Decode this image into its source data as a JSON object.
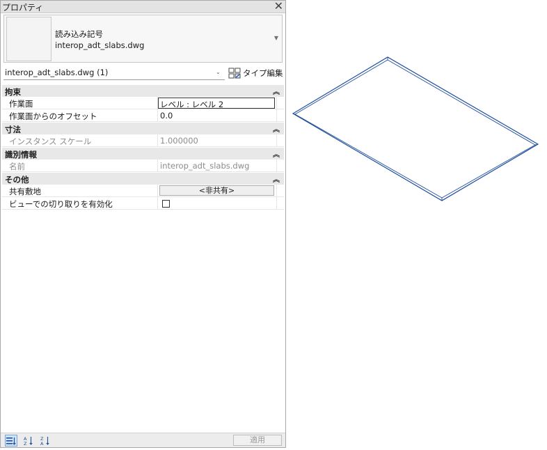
{
  "palette": {
    "title": "プロパティ",
    "close_glyph": "✕",
    "type_selector": {
      "family": "読み込み記号",
      "type": "interop_adt_slabs.dwg",
      "dropdown_glyph": "▼"
    },
    "instance_filter": {
      "label": "interop_adt_slabs.dwg (1)",
      "dropdown_glyph": "⌄",
      "edit_type_label": "タイプ編集"
    },
    "groups": [
      {
        "name": "拘束",
        "chevron": "≈",
        "rows": [
          {
            "label": "作業面",
            "value": "レベル : レベル 2"
          },
          {
            "label": "作業面からのオフセット",
            "value": "0.0"
          }
        ]
      },
      {
        "name": "寸法",
        "chevron": "≈",
        "rows": [
          {
            "label": "インスタンス スケール",
            "value": "1.000000"
          }
        ]
      },
      {
        "name": "識別情報",
        "chevron": "≈",
        "rows": [
          {
            "label": "名前",
            "value": "interop_adt_slabs.dwg"
          }
        ]
      },
      {
        "name": "その他",
        "chevron": "≈",
        "rows": [
          {
            "label": "共有敷地",
            "value": "<非共有>"
          },
          {
            "label": "ビューでの切り取りを有効化",
            "value": false
          }
        ]
      }
    ],
    "footer": {
      "apply_label": "適用"
    }
  },
  "colors": {
    "accent": "#1f4e9c",
    "group_header_bg": "#e8e8e8",
    "selected_icon_bg": "#cfe3f6"
  }
}
